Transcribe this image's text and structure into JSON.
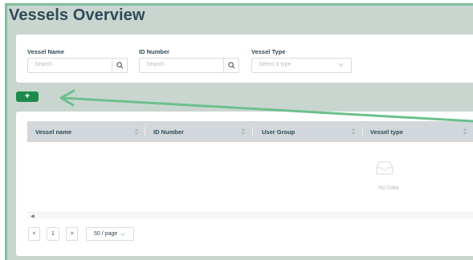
{
  "page": {
    "title": "Vessels Overview"
  },
  "filters": {
    "vessel_name": {
      "label": "Vessel Name",
      "placeholder": "Search"
    },
    "id_number": {
      "label": "ID Number",
      "placeholder": "Search"
    },
    "vessel_type": {
      "label": "Vessel Type",
      "placeholder": "Select a type"
    }
  },
  "toolbar": {
    "add_label": "+"
  },
  "table": {
    "columns": [
      "Vessel name",
      "ID Number",
      "User Group",
      "Vessel type"
    ],
    "empty_text": "No Data",
    "scroll_left_glyph": "◀"
  },
  "pagination": {
    "prev_glyph": "<",
    "current_page": "1",
    "next_glyph": ">",
    "page_size": "50 / page"
  },
  "colors": {
    "accent_green": "#1e8a4c",
    "annotation_arrow": "#6cc08e",
    "title_text": "#2f4a57",
    "backdrop": "#c9d6d0"
  },
  "icons": [
    "search-icon",
    "chevron-down-icon",
    "sort-icon",
    "empty-inbox-icon",
    "arrow-annotation"
  ]
}
